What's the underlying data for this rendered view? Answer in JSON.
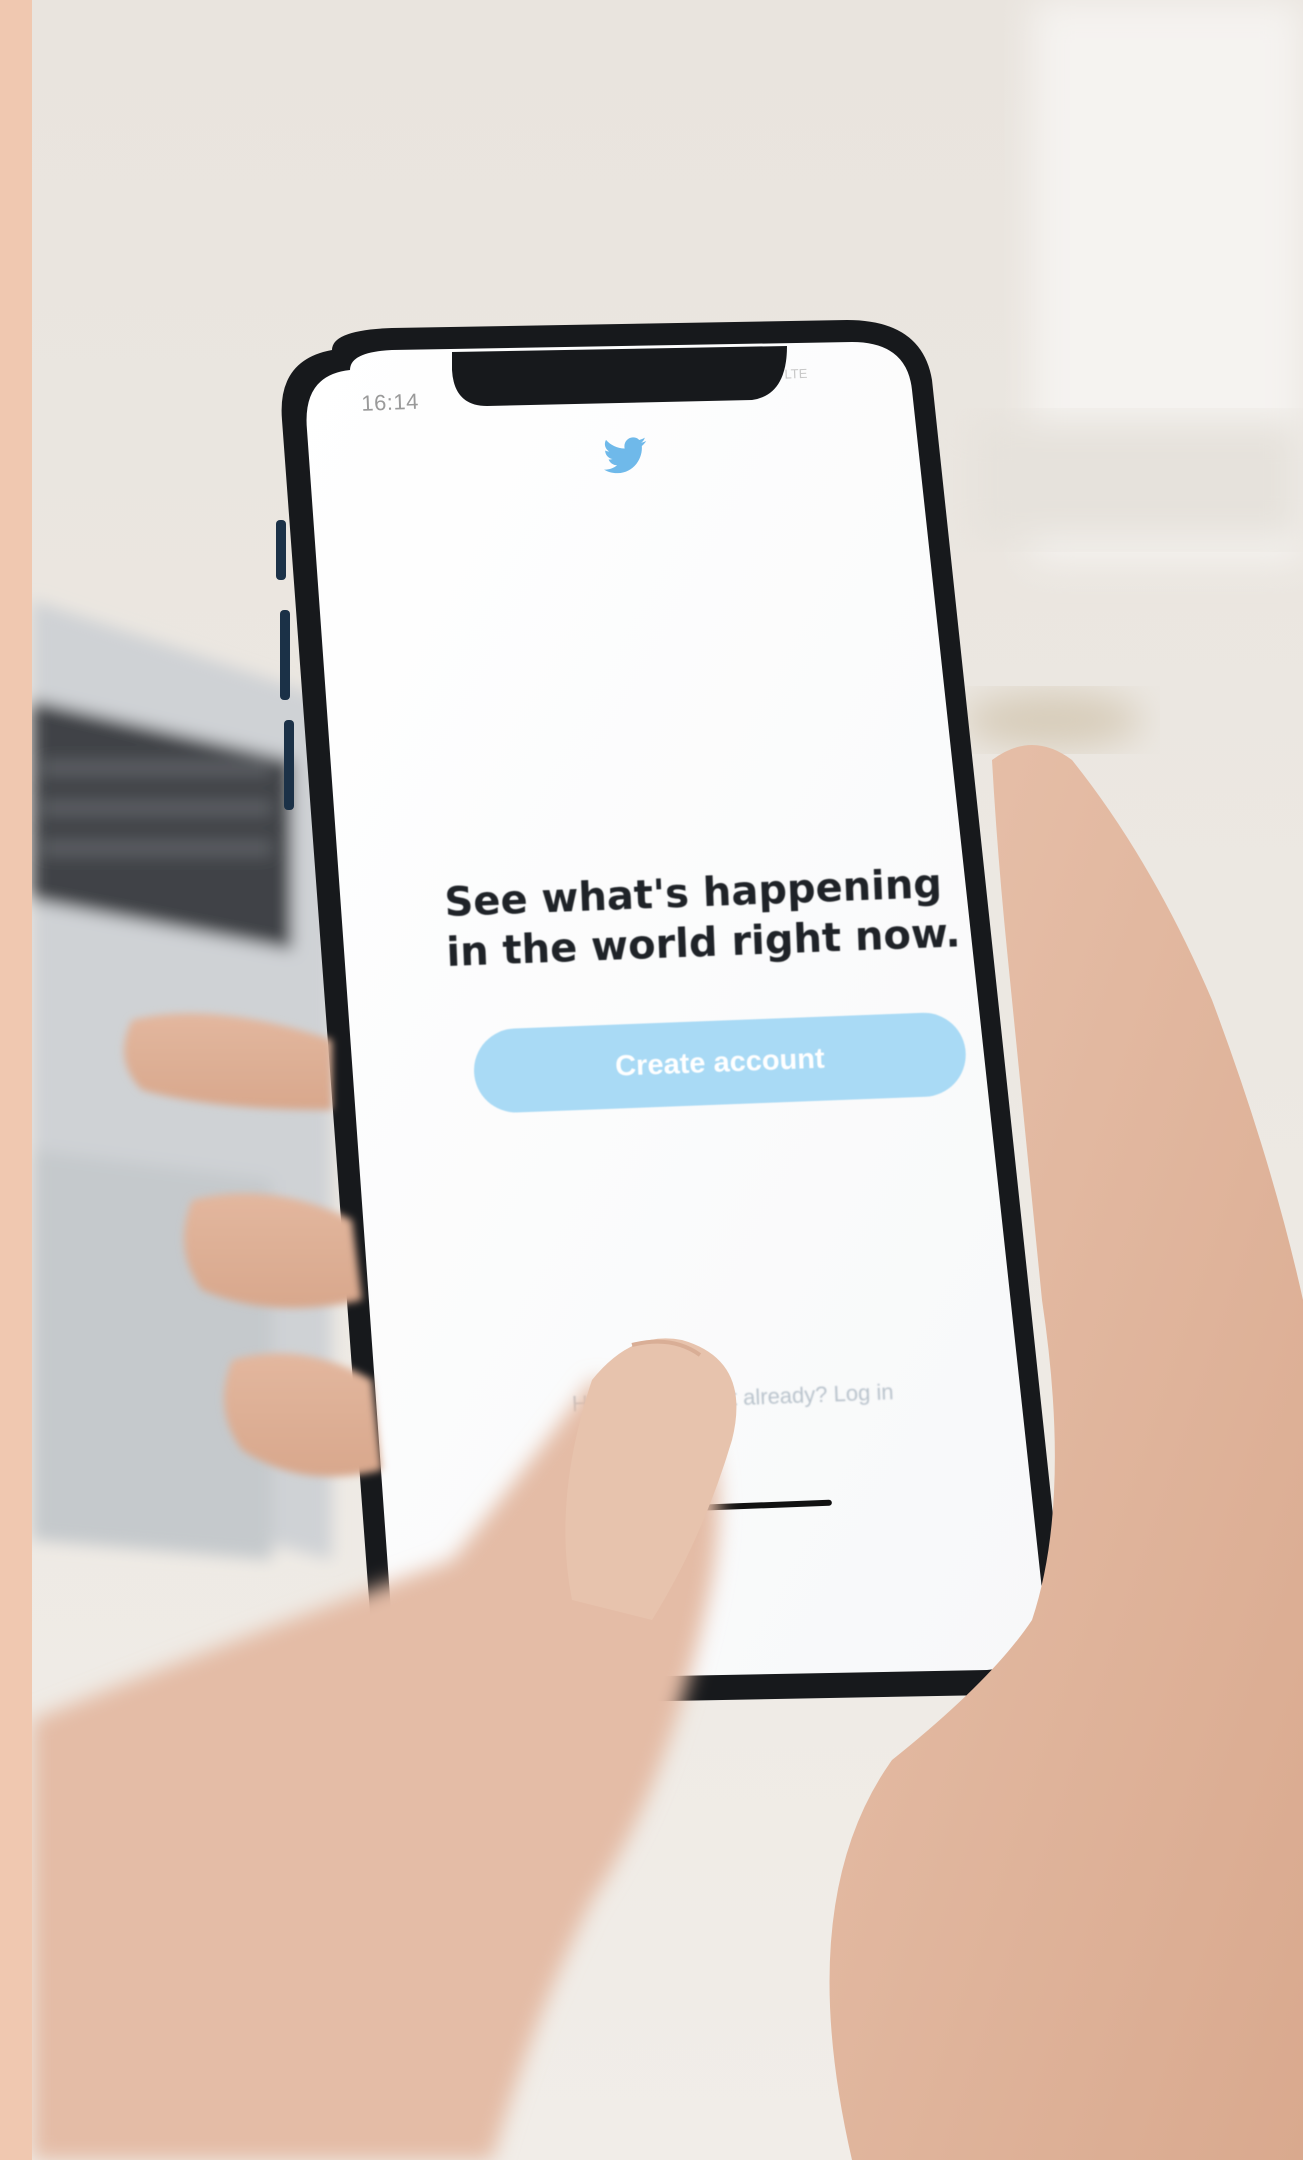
{
  "screen": {
    "status_time": "16:14",
    "status_right": "LTE",
    "logo_icon": "twitter-bird-icon",
    "headline": "See what's happening in the world right now.",
    "create_account_label": "Create account",
    "login_prompt": "Have an account already? Log in"
  },
  "colors": {
    "left_strip": "#f0c8b0",
    "brand_blue": "#1da1f2",
    "button_fill": "#a9daf5",
    "headline": "#1f2328"
  }
}
